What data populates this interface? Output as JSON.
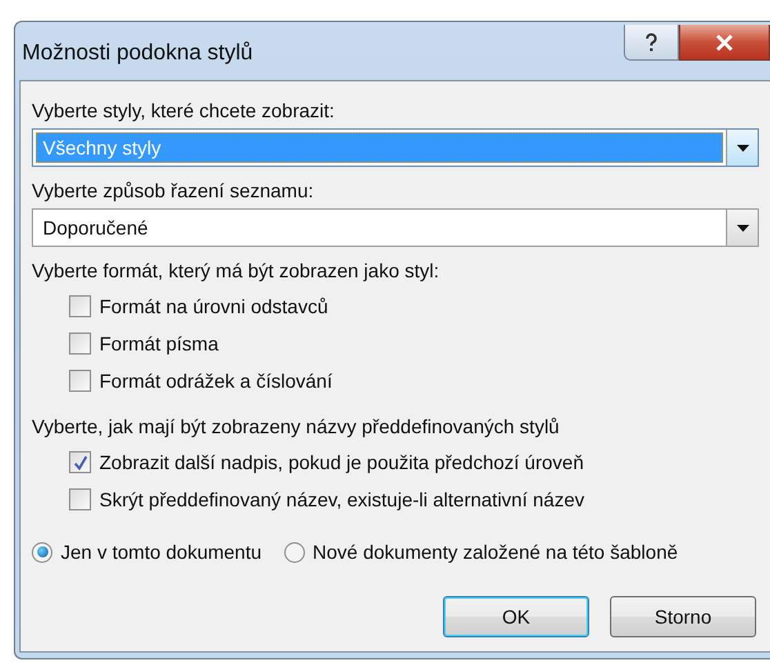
{
  "window": {
    "title": "Možnosti podokna stylů"
  },
  "dropdowns": [
    {
      "label": "Vyberte styly, které chcete zobrazit:",
      "value": "Všechny styly",
      "focused": true
    },
    {
      "label": "Vyberte způsob řazení seznamu:",
      "value": "Doporučené",
      "focused": false
    }
  ],
  "option_groups": [
    {
      "label": "Vyberte formát, který má být zobrazen jako styl:",
      "checkboxes": [
        {
          "label": "Formát na úrovni odstavců",
          "checked": false
        },
        {
          "label": "Formát písma",
          "checked": false
        },
        {
          "label": "Formát odrážek a číslování",
          "checked": false
        }
      ]
    },
    {
      "label": "Vyberte, jak mají být zobrazeny názvy předdefinovaných stylů",
      "checkboxes": [
        {
          "label": "Zobrazit další nadpis, pokud je použita předchozí úroveň",
          "checked": true
        },
        {
          "label": "Skrýt předdefinovaný název, existuje-li alternativní název",
          "checked": false
        }
      ]
    }
  ],
  "scope": [
    {
      "label": "Jen v tomto dokumentu",
      "selected": true
    },
    {
      "label": "Nové dokumenty založené na této šabloně",
      "selected": false
    }
  ],
  "buttons": [
    {
      "label": "OK",
      "default": true
    },
    {
      "label": "Storno",
      "default": false
    }
  ]
}
